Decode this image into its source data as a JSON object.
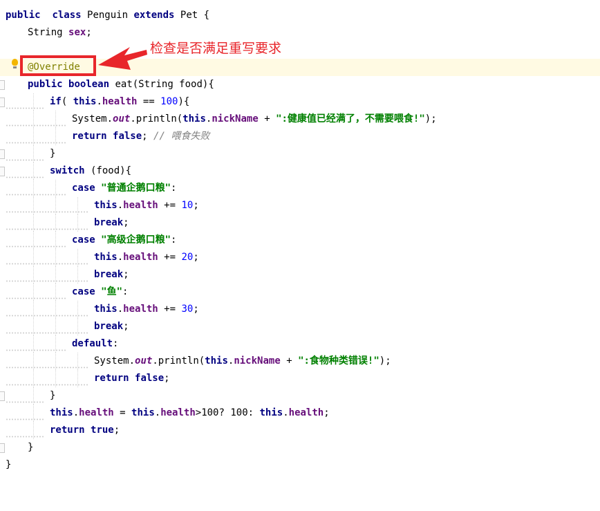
{
  "editor": {
    "lines": [
      {
        "indent": 0,
        "tokens": [
          [
            "kw",
            "public"
          ],
          [
            "",
            "  "
          ],
          [
            "kw",
            "class"
          ],
          [
            "",
            " Penguin "
          ],
          [
            "kw",
            "extends"
          ],
          [
            "",
            " Pet {"
          ]
        ]
      },
      {
        "indent": 1,
        "tokens": [
          [
            "",
            "String "
          ],
          [
            "fld",
            "sex"
          ],
          [
            "",
            ";"
          ]
        ]
      },
      {
        "indent": 0,
        "tokens": []
      },
      {
        "indent": 1,
        "highlight": true,
        "tokens": [
          [
            "ann",
            "@Override"
          ]
        ]
      },
      {
        "indent": 1,
        "tokens": [
          [
            "kw",
            "public"
          ],
          [
            "",
            " "
          ],
          [
            "kw",
            "boolean"
          ],
          [
            "",
            " eat(String food){"
          ]
        ]
      },
      {
        "indent": 2,
        "tokens": [
          [
            "kw",
            "if"
          ],
          [
            "",
            "( "
          ],
          [
            "kw",
            "this"
          ],
          [
            "",
            "."
          ],
          [
            "fld",
            "health"
          ],
          [
            "",
            " == "
          ],
          [
            "num",
            "100"
          ],
          [
            "",
            "){"
          ]
        ]
      },
      {
        "indent": 3,
        "tokens": [
          [
            "",
            "System."
          ],
          [
            "static-field",
            "out"
          ],
          [
            "",
            ".println("
          ],
          [
            "kw",
            "this"
          ],
          [
            "",
            "."
          ],
          [
            "fld",
            "nickName"
          ],
          [
            "",
            " + "
          ],
          [
            "str",
            "\":健康值已经满了，不需要喂食!\""
          ],
          [
            "",
            ");"
          ]
        ]
      },
      {
        "indent": 3,
        "tokens": [
          [
            "kw",
            "return"
          ],
          [
            "",
            " "
          ],
          [
            "kw",
            "false"
          ],
          [
            "",
            "; "
          ],
          [
            "cmt",
            "// 喂食失败"
          ]
        ]
      },
      {
        "indent": 2,
        "tokens": [
          [
            "",
            "}"
          ]
        ]
      },
      {
        "indent": 2,
        "tokens": [
          [
            "kw",
            "switch"
          ],
          [
            "",
            " (food){"
          ]
        ]
      },
      {
        "indent": 3,
        "tokens": [
          [
            "kw",
            "case"
          ],
          [
            "",
            " "
          ],
          [
            "str",
            "\"普通企鹅口粮\""
          ],
          [
            "",
            ":"
          ]
        ]
      },
      {
        "indent": 4,
        "tokens": [
          [
            "kw",
            "this"
          ],
          [
            "",
            "."
          ],
          [
            "fld",
            "health"
          ],
          [
            "",
            " += "
          ],
          [
            "num",
            "10"
          ],
          [
            "",
            ";"
          ]
        ]
      },
      {
        "indent": 4,
        "tokens": [
          [
            "kw",
            "break"
          ],
          [
            "",
            ";"
          ]
        ]
      },
      {
        "indent": 3,
        "tokens": [
          [
            "kw",
            "case"
          ],
          [
            "",
            " "
          ],
          [
            "str",
            "\"高级企鹅口粮\""
          ],
          [
            "",
            ":"
          ]
        ]
      },
      {
        "indent": 4,
        "tokens": [
          [
            "kw",
            "this"
          ],
          [
            "",
            "."
          ],
          [
            "fld",
            "health"
          ],
          [
            "",
            " += "
          ],
          [
            "num",
            "20"
          ],
          [
            "",
            ";"
          ]
        ]
      },
      {
        "indent": 4,
        "tokens": [
          [
            "kw",
            "break"
          ],
          [
            "",
            ";"
          ]
        ]
      },
      {
        "indent": 3,
        "tokens": [
          [
            "kw",
            "case"
          ],
          [
            "",
            " "
          ],
          [
            "str",
            "\"鱼\""
          ],
          [
            "",
            ":"
          ]
        ]
      },
      {
        "indent": 4,
        "tokens": [
          [
            "kw",
            "this"
          ],
          [
            "",
            "."
          ],
          [
            "fld",
            "health"
          ],
          [
            "",
            " += "
          ],
          [
            "num",
            "30"
          ],
          [
            "",
            ";"
          ]
        ]
      },
      {
        "indent": 4,
        "tokens": [
          [
            "kw",
            "break"
          ],
          [
            "",
            ";"
          ]
        ]
      },
      {
        "indent": 3,
        "tokens": [
          [
            "kw",
            "default"
          ],
          [
            "",
            ":"
          ]
        ]
      },
      {
        "indent": 4,
        "tokens": [
          [
            "",
            "System."
          ],
          [
            "static-field",
            "out"
          ],
          [
            "",
            ".println("
          ],
          [
            "kw",
            "this"
          ],
          [
            "",
            "."
          ],
          [
            "fld",
            "nickName"
          ],
          [
            "",
            " + "
          ],
          [
            "str",
            "\":食物种类错误!\""
          ],
          [
            "",
            ");"
          ]
        ]
      },
      {
        "indent": 4,
        "tokens": [
          [
            "kw",
            "return"
          ],
          [
            "",
            " "
          ],
          [
            "kw",
            "false"
          ],
          [
            "",
            ";"
          ]
        ]
      },
      {
        "indent": 2,
        "tokens": [
          [
            "",
            "}"
          ]
        ]
      },
      {
        "indent": 2,
        "tokens": [
          [
            "kw",
            "this"
          ],
          [
            "",
            "."
          ],
          [
            "fld",
            "health"
          ],
          [
            "",
            " = "
          ],
          [
            "kw",
            "this"
          ],
          [
            "",
            "."
          ],
          [
            "fld",
            "health"
          ],
          [
            "",
            ">100? 100: "
          ],
          [
            "kw",
            "this"
          ],
          [
            "",
            "."
          ],
          [
            "fld",
            "health"
          ],
          [
            "",
            ";"
          ]
        ]
      },
      {
        "indent": 2,
        "tokens": [
          [
            "kw",
            "return"
          ],
          [
            "",
            " "
          ],
          [
            "kw",
            "true"
          ],
          [
            "",
            ";"
          ]
        ]
      },
      {
        "indent": 1,
        "tokens": [
          [
            "",
            "}"
          ]
        ]
      },
      {
        "indent": 0,
        "tokens": [
          [
            "",
            "}"
          ]
        ]
      }
    ]
  },
  "annotation": {
    "label": "检查是否满足重写要求",
    "color": "#e8262b"
  },
  "icons": {
    "bulb": "intention-bulb-icon"
  }
}
